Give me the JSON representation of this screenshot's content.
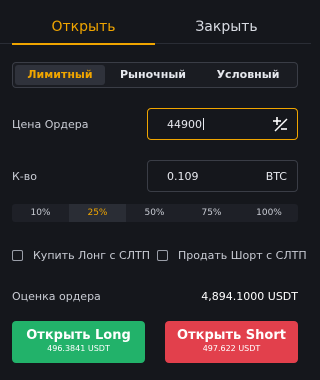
{
  "tabs": {
    "open": "Открыть",
    "close": "Закрыть"
  },
  "order_types": [
    "Лимитный",
    "Рыночный",
    "Условный"
  ],
  "price": {
    "label": "Цена Ордера",
    "value": "44900"
  },
  "qty": {
    "label": "К-во",
    "value": "0.109",
    "unit": "BTC"
  },
  "percents": [
    "10%",
    "25%",
    "50%",
    "75%",
    "100%"
  ],
  "checkboxes": {
    "long": "Купить Лонг с СЛТП",
    "short": "Продать Шорт с СЛТП"
  },
  "estimate": {
    "label": "Оценка ордера",
    "value": "4,894.1000 USDT"
  },
  "buttons": {
    "long": {
      "label": "Открыть Long",
      "sub": "496.3841 USDT"
    },
    "short": {
      "label": "Открыть Short",
      "sub": "497.622 USDT"
    }
  },
  "colors": {
    "accent": "#f0a500",
    "long": "#22b26a",
    "short": "#e2404c",
    "background": "#15171c"
  },
  "icons": {
    "price_adjust": "plus-minus-icon"
  }
}
